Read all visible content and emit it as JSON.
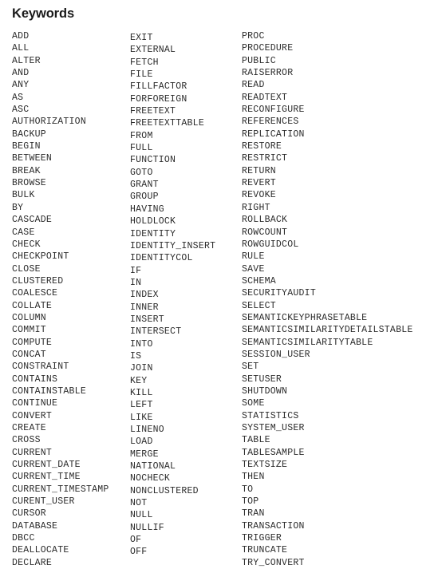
{
  "document": {
    "title": "Keywords",
    "background_color": "#ffffff",
    "text_color": "#2b2b2b",
    "title_color": "#1a1a1a"
  },
  "columns": [
    {
      "name": "keyword-column-1",
      "items": [
        "ADD",
        "ALL",
        "ALTER",
        "AND",
        "ANY",
        "AS",
        "ASC",
        "AUTHORIZATION",
        "BACKUP",
        "BEGIN",
        "BETWEEN",
        "BREAK",
        "BROWSE",
        "BULK",
        "BY",
        "CASCADE",
        "CASE",
        "CHECK",
        "CHECKPOINT",
        "CLOSE",
        "CLUSTERED",
        "COALESCE",
        "COLLATE",
        "COLUMN",
        "COMMIT",
        "COMPUTE",
        "CONCAT",
        "CONSTRAINT",
        "CONTAINS",
        "CONTAINSTABLE",
        "CONTINUE",
        "CONVERT",
        "CREATE",
        "CROSS",
        "CURRENT",
        "CURRENT_DATE",
        "CURRENT_TIME",
        "CURRENT_TIMESTAMP",
        "CURENT_USER",
        "CURSOR",
        "DATABASE",
        "DBCC",
        "DEALLOCATE",
        "DECLARE"
      ]
    },
    {
      "name": "keyword-column-2",
      "items": [
        "EXIT",
        "EXTERNAL",
        "FETCH",
        "FILE",
        "FILLFACTOR",
        "FORFOREIGN",
        "FREETEXT",
        "FREETEXTTABLE",
        "FROM",
        "FULL",
        "FUNCTION",
        "GOTO",
        "GRANT",
        "GROUP",
        "HAVING",
        "HOLDLOCK",
        "IDENTITY",
        "IDENTITY_INSERT",
        "IDENTITYCOL",
        "IF",
        "IN",
        "INDEX",
        "INNER",
        "INSERT",
        "INTERSECT",
        "INTO",
        "IS",
        "JOIN",
        "KEY",
        "KILL",
        "LEFT",
        "LIKE",
        "LINENO",
        "LOAD",
        "MERGE",
        "NATIONAL",
        "NOCHECK",
        "NONCLUSTERED",
        "NOT",
        "NULL",
        "NULLIF",
        "OF",
        "OFF"
      ]
    },
    {
      "name": "keyword-column-3",
      "items": [
        "PROC",
        "PROCEDURE",
        "PUBLIC",
        "RAISERROR",
        "READ",
        "READTEXT",
        "RECONFIGURE",
        "REFERENCES",
        "REPLICATION",
        "RESTORE",
        "RESTRICT",
        "RETURN",
        "REVERT",
        "REVOKE",
        "RIGHT",
        "ROLLBACK",
        "ROWCOUNT",
        "ROWGUIDCOL",
        "RULE",
        "SAVE",
        "SCHEMA",
        "SECURITYAUDIT",
        "SELECT",
        "SEMANTICKEYPHRASETABLE",
        "SEMANTICSIMILARITYDETAILSTABLE",
        "SEMANTICSIMILARITYTABLE",
        "SESSION_USER",
        "SET",
        "SETUSER",
        "SHUTDOWN",
        "SOME",
        "STATISTICS",
        "SYSTEM_USER",
        "TABLE",
        "TABLESAMPLE",
        "TEXTSIZE",
        "THEN",
        "TO",
        "TOP",
        "TRAN",
        "TRANSACTION",
        "TRIGGER",
        "TRUNCATE",
        "TRY_CONVERT"
      ]
    }
  ]
}
